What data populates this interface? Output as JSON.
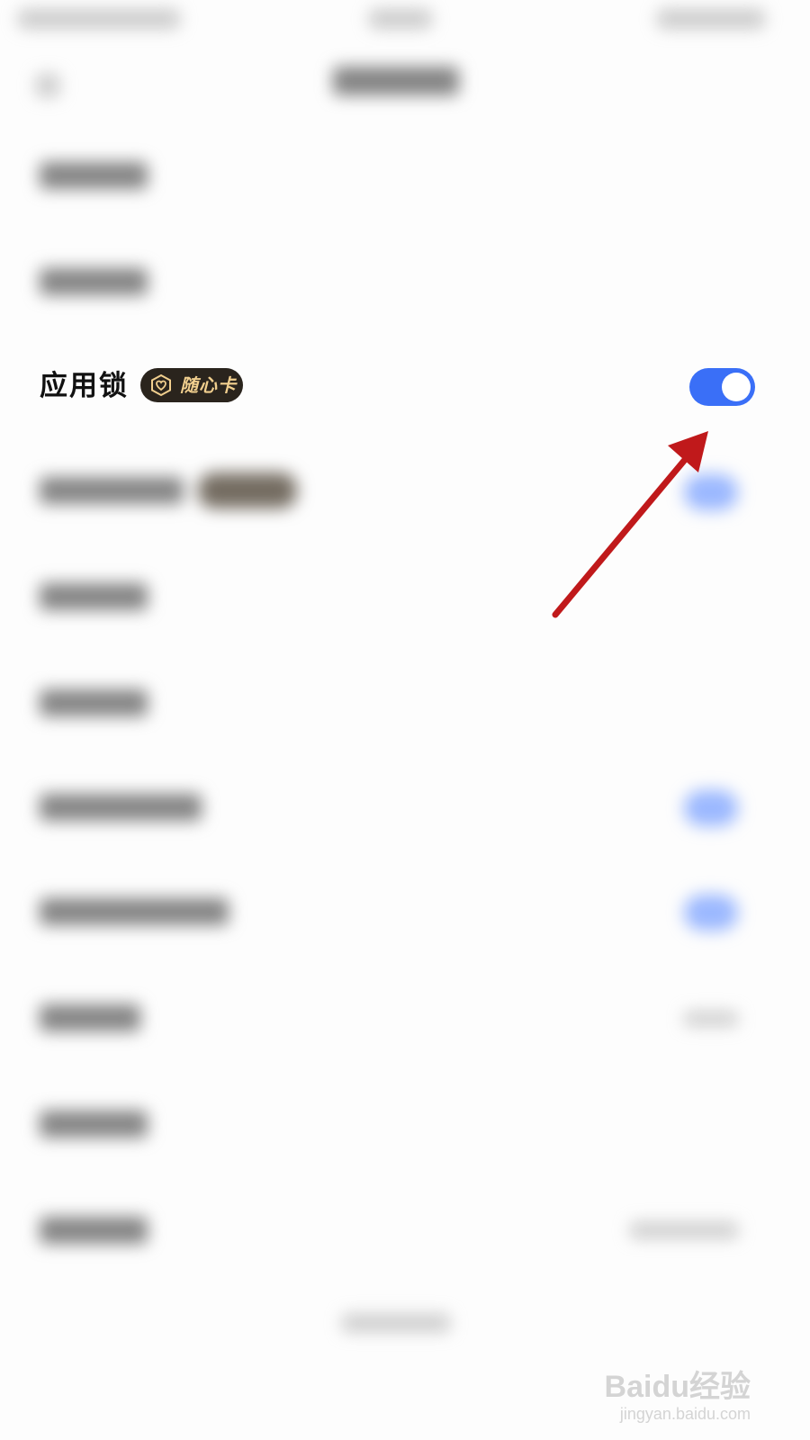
{
  "app_lock_row": {
    "label": "应用锁",
    "badge_text": "随心卡",
    "badge_icon": "heart-hexagon-icon",
    "toggle_on": true
  },
  "annotation": {
    "arrow_color": "#c0191b",
    "points_to": "app-lock-toggle"
  },
  "watermark": {
    "logo": "Baidu经验",
    "url": "jingyan.baidu.com"
  },
  "colors": {
    "toggle_on": "#3a6ff7",
    "badge_bg": "#2a241d",
    "badge_text": "#f1cf8e"
  }
}
